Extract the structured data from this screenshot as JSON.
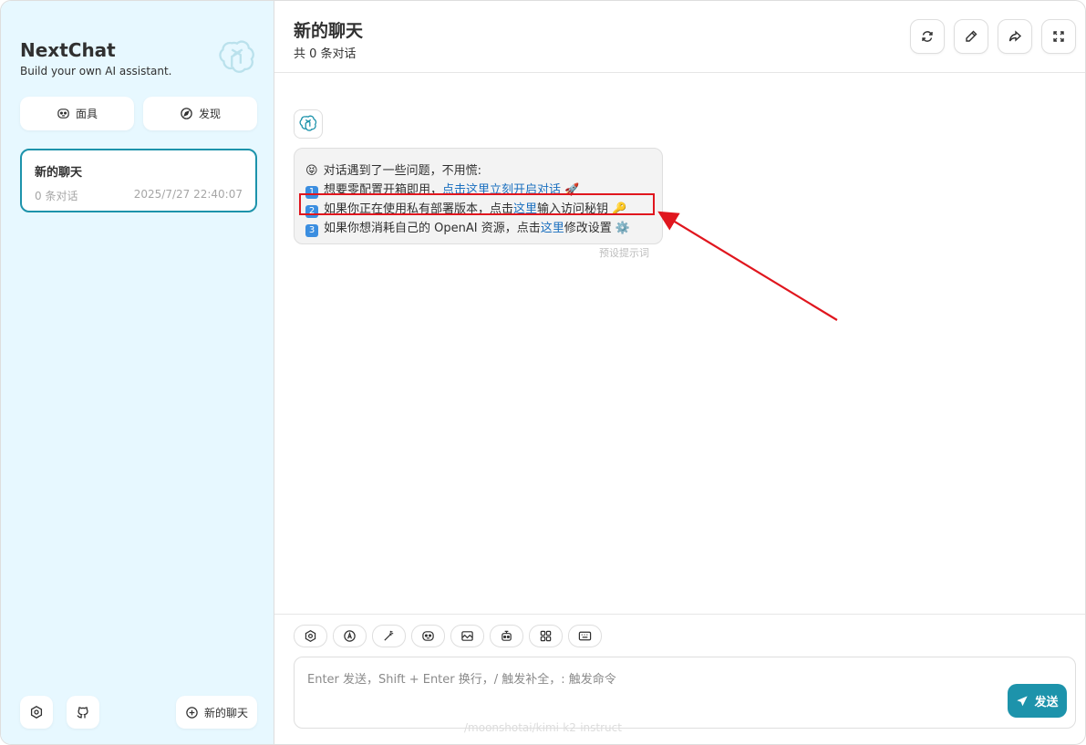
{
  "sidebar": {
    "title": "NextChat",
    "subtitle": "Build your own AI assistant.",
    "mask_label": "面具",
    "discover_label": "发现",
    "chat_item": {
      "title": "新的聊天",
      "count": "0 条对话",
      "time": "2025/7/27 22:40:07"
    },
    "new_chat_label": "新的聊天"
  },
  "header": {
    "title": "新的聊天",
    "subtitle": "共 0 条对话"
  },
  "message": {
    "line1": "对话遇到了一些问题，不用慌:",
    "line1_emoji": "😝",
    "line2_prefix": "想要零配置开箱即用，",
    "line2_link": "点击这里立刻开启对话",
    "line2_emoji": "🚀",
    "line3_prefix": "如果你正在使用私有部署版本，点击",
    "line3_link": "这里",
    "line3_suffix": "输入访问秘钥",
    "line3_emoji": "🔑",
    "line4_prefix": "如果你想消耗自己的 OpenAI 资源，点击",
    "line4_link": "这里",
    "line4_suffix": "修改设置",
    "line4_emoji": "⚙️",
    "num1": "1",
    "num2": "2",
    "num3": "3",
    "date": "预设提示词"
  },
  "composer": {
    "placeholder": "Enter 发送，Shift + Enter 换行，/ 触发补全，: 触发命令",
    "send_label": "发送",
    "watermark": "/moonshotai/kimi-k2-instruct"
  },
  "colors": {
    "accent": "#1d93ab",
    "sidebar_bg": "#e7f8ff",
    "highlight": "#e0161e"
  }
}
